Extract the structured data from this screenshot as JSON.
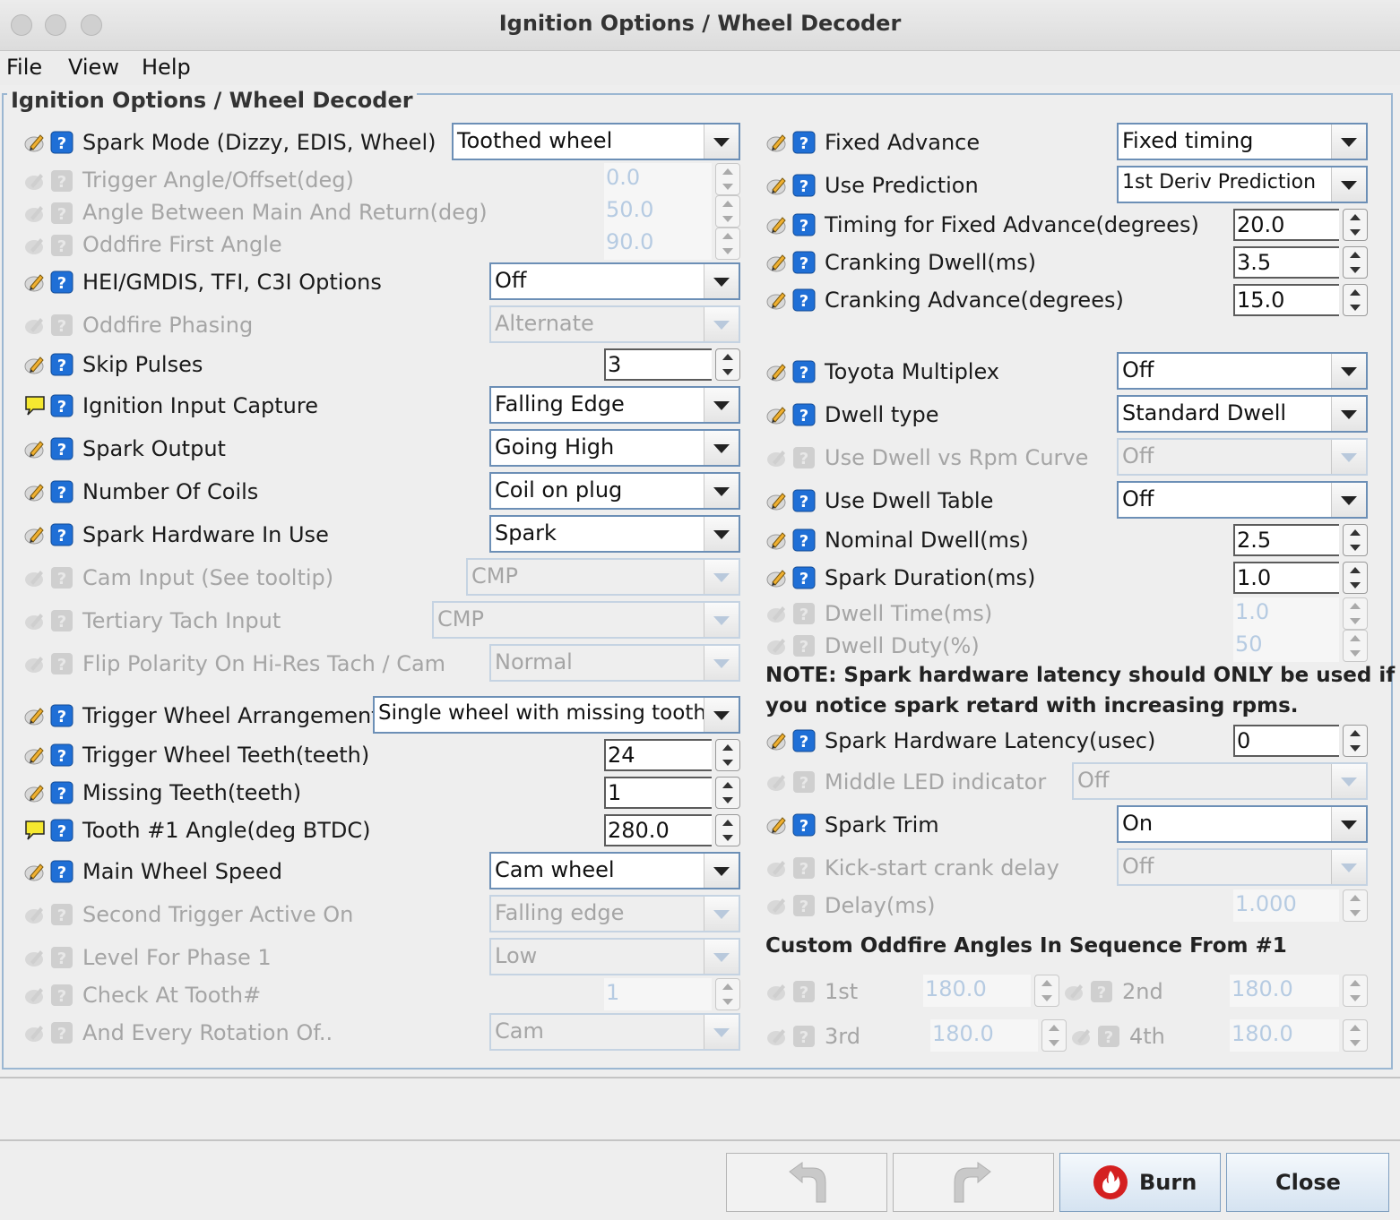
{
  "window": {
    "title": "Ignition Options / Wheel Decoder",
    "menu": [
      "File",
      "View",
      "Help"
    ]
  },
  "panel": {
    "title": "Ignition Options / Wheel Decoder"
  },
  "left": {
    "spark_mode": {
      "label": "Spark Mode (Dizzy, EDIS, Wheel)",
      "value": "Toothed wheel"
    },
    "trigger_angle": {
      "label": "Trigger Angle/Offset(deg)",
      "value": "0.0"
    },
    "angle_between": {
      "label": "Angle Between Main And Return(deg)",
      "value": "50.0"
    },
    "oddfire_first": {
      "label": "Oddfire First Angle",
      "value": "90.0"
    },
    "hei_options": {
      "label": "HEI/GMDIS, TFI, C3I Options",
      "value": "Off"
    },
    "oddfire_phasing": {
      "label": "Oddfire Phasing",
      "value": "Alternate"
    },
    "skip_pulses": {
      "label": "Skip Pulses",
      "value": "3"
    },
    "ign_input_capture": {
      "label": "Ignition Input Capture",
      "value": "Falling Edge"
    },
    "spark_output": {
      "label": "Spark Output",
      "value": "Going High"
    },
    "num_coils": {
      "label": "Number Of Coils",
      "value": "Coil on plug"
    },
    "spark_hw": {
      "label": "Spark Hardware In Use",
      "value": "Spark"
    },
    "cam_input": {
      "label": "Cam Input (See tooltip)",
      "value": "CMP"
    },
    "tertiary_tach": {
      "label": "Tertiary Tach Input",
      "value": "CMP"
    },
    "flip_polarity": {
      "label": "Flip Polarity On Hi-Res Tach / Cam",
      "value": "Normal"
    },
    "trigger_arrangement": {
      "label": "Trigger Wheel Arrangement",
      "value": "Single wheel with missing tooth"
    },
    "trigger_teeth": {
      "label": "Trigger Wheel Teeth(teeth)",
      "value": "24"
    },
    "missing_teeth": {
      "label": "Missing Teeth(teeth)",
      "value": "1"
    },
    "tooth1_angle": {
      "label": "Tooth #1 Angle(deg BTDC)",
      "value": "280.0"
    },
    "main_wheel_speed": {
      "label": "Main Wheel Speed",
      "value": "Cam wheel"
    },
    "second_trigger": {
      "label": "Second Trigger Active On",
      "value": "Falling edge"
    },
    "level_phase1": {
      "label": "Level For Phase 1",
      "value": "Low"
    },
    "check_tooth": {
      "label": "Check At Tooth#",
      "value": "1"
    },
    "every_rotation": {
      "label": "And Every Rotation Of..",
      "value": "Cam"
    }
  },
  "right": {
    "fixed_advance": {
      "label": "Fixed Advance",
      "value": "Fixed timing"
    },
    "use_prediction": {
      "label": "Use Prediction",
      "value": "1st Deriv Prediction"
    },
    "timing_fixed": {
      "label": "Timing for Fixed Advance(degrees)",
      "value": "20.0"
    },
    "cranking_dwell": {
      "label": "Cranking Dwell(ms)",
      "value": "3.5"
    },
    "cranking_advance": {
      "label": "Cranking Advance(degrees)",
      "value": "15.0"
    },
    "toyota_multiplex": {
      "label": "Toyota Multiplex",
      "value": "Off"
    },
    "dwell_type": {
      "label": "Dwell type",
      "value": "Standard Dwell"
    },
    "dwell_rpm_curve": {
      "label": "Use Dwell vs Rpm Curve",
      "value": "Off"
    },
    "dwell_table": {
      "label": "Use Dwell Table",
      "value": "Off"
    },
    "nominal_dwell": {
      "label": "Nominal Dwell(ms)",
      "value": "2.5"
    },
    "spark_duration": {
      "label": "Spark Duration(ms)",
      "value": "1.0"
    },
    "dwell_time": {
      "label": "Dwell Time(ms)",
      "value": "1.0"
    },
    "dwell_duty": {
      "label": "Dwell Duty(%)",
      "value": "50"
    },
    "note_line1": "NOTE: Spark hardware latency should ONLY be used if",
    "note_line2": "you notice spark retard with increasing rpms.",
    "hw_latency": {
      "label": "Spark Hardware Latency(usec)",
      "value": "0"
    },
    "middle_led": {
      "label": "Middle LED indicator",
      "value": "Off"
    },
    "spark_trim": {
      "label": "Spark Trim",
      "value": "On"
    },
    "kickstart_delay": {
      "label": "Kick-start crank delay",
      "value": "Off"
    },
    "delay_ms": {
      "label": "Delay(ms)",
      "value": "1.000"
    },
    "oddfire_header": "Custom Oddfire Angles In Sequence From #1",
    "odd1": {
      "label": "1st",
      "value": "180.0"
    },
    "odd2": {
      "label": "2nd",
      "value": "180.0"
    },
    "odd3": {
      "label": "3rd",
      "value": "180.0"
    },
    "odd4": {
      "label": "4th",
      "value": "180.0"
    }
  },
  "buttons": {
    "burn": "Burn",
    "close": "Close"
  },
  "colors": {
    "accent": "#1f6fd6",
    "disabled_text": "#a5a5a5",
    "burn_icon": "#d42020"
  }
}
